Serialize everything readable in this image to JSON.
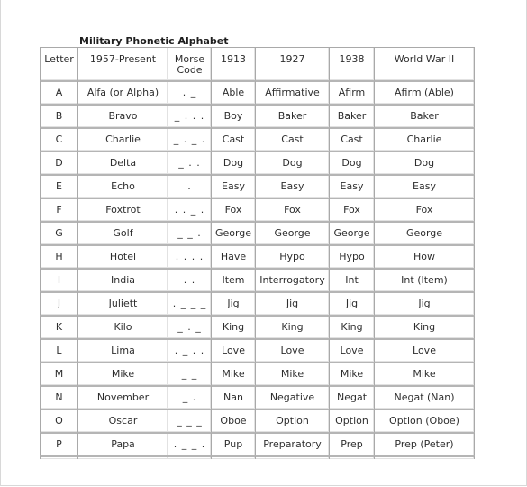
{
  "title": "Military Phonetic Alphabet",
  "columns": [
    "Letter",
    "1957-Present",
    "Morse Code",
    "1913",
    "1927",
    "1938",
    "World War II"
  ],
  "rows": [
    {
      "letter": "A",
      "present": "Alfa (or Alpha)",
      "morse": ". _",
      "y1913": "Able",
      "y1927": "Affirmative",
      "y1938": "Afirm",
      "ww2": "Afirm (Able)"
    },
    {
      "letter": "B",
      "present": "Bravo",
      "morse": "_ . . .",
      "y1913": "Boy",
      "y1927": "Baker",
      "y1938": "Baker",
      "ww2": "Baker"
    },
    {
      "letter": "C",
      "present": "Charlie",
      "morse": "_ . _ .",
      "y1913": "Cast",
      "y1927": "Cast",
      "y1938": "Cast",
      "ww2": "Charlie"
    },
    {
      "letter": "D",
      "present": "Delta",
      "morse": "_ . .",
      "y1913": "Dog",
      "y1927": "Dog",
      "y1938": "Dog",
      "ww2": "Dog"
    },
    {
      "letter": "E",
      "present": "Echo",
      "morse": ".",
      "y1913": "Easy",
      "y1927": "Easy",
      "y1938": "Easy",
      "ww2": "Easy"
    },
    {
      "letter": "F",
      "present": "Foxtrot",
      "morse": ". . _ .",
      "y1913": "Fox",
      "y1927": "Fox",
      "y1938": "Fox",
      "ww2": "Fox"
    },
    {
      "letter": "G",
      "present": "Golf",
      "morse": "_ _ .",
      "y1913": "George",
      "y1927": "George",
      "y1938": "George",
      "ww2": "George"
    },
    {
      "letter": "H",
      "present": "Hotel",
      "morse": ". . . .",
      "y1913": "Have",
      "y1927": "Hypo",
      "y1938": "Hypo",
      "ww2": "How"
    },
    {
      "letter": "I",
      "present": "India",
      "morse": ". .",
      "y1913": "Item",
      "y1927": "Interrogatory",
      "y1938": "Int",
      "ww2": "Int (Item)"
    },
    {
      "letter": "J",
      "present": "Juliett",
      "morse": ". _ _ _",
      "y1913": "Jig",
      "y1927": "Jig",
      "y1938": "Jig",
      "ww2": "Jig"
    },
    {
      "letter": "K",
      "present": "Kilo",
      "morse": "_ . _",
      "y1913": "King",
      "y1927": "King",
      "y1938": "King",
      "ww2": "King"
    },
    {
      "letter": "L",
      "present": "Lima",
      "morse": ". _ . .",
      "y1913": "Love",
      "y1927": "Love",
      "y1938": "Love",
      "ww2": "Love"
    },
    {
      "letter": "M",
      "present": "Mike",
      "morse": "_ _",
      "y1913": "Mike",
      "y1927": "Mike",
      "y1938": "Mike",
      "ww2": "Mike"
    },
    {
      "letter": "N",
      "present": "November",
      "morse": "_ .",
      "y1913": "Nan",
      "y1927": "Negative",
      "y1938": "Negat",
      "ww2": "Negat (Nan)"
    },
    {
      "letter": "O",
      "present": "Oscar",
      "morse": "_ _ _",
      "y1913": "Oboe",
      "y1927": "Option",
      "y1938": "Option",
      "ww2": "Option (Oboe)"
    },
    {
      "letter": "P",
      "present": "Papa",
      "morse": ". _ _ .",
      "y1913": "Pup",
      "y1927": "Preparatory",
      "y1938": "Prep",
      "ww2": "Prep (Peter)"
    }
  ]
}
